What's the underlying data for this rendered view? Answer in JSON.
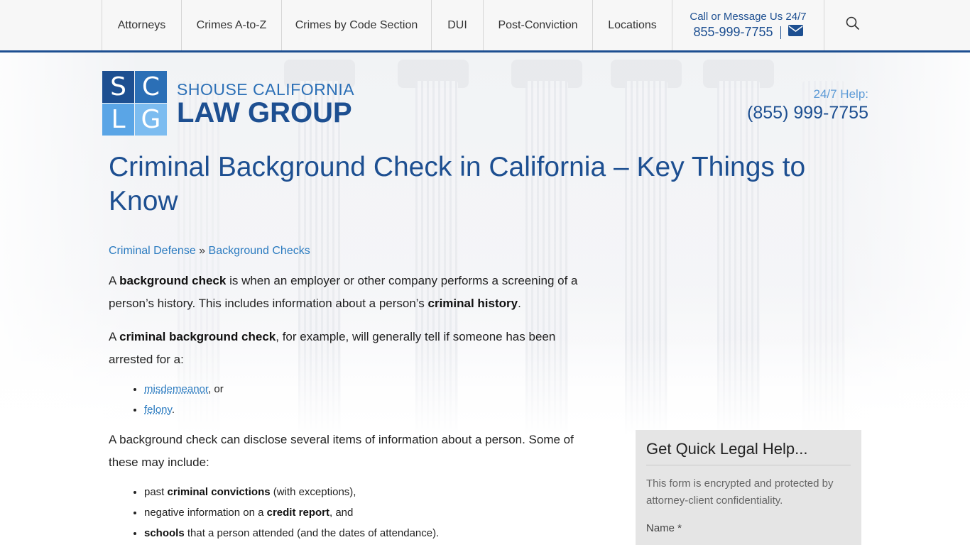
{
  "nav": {
    "items": [
      {
        "label": "Attorneys"
      },
      {
        "label": "Crimes A-to-Z"
      },
      {
        "label": "Crimes by Code Section"
      },
      {
        "label": "DUI"
      },
      {
        "label": "Post-Conviction"
      },
      {
        "label": "Locations"
      }
    ],
    "call_label": "Call or Message Us 24/7",
    "call_phone": "855-999-7755",
    "icons": [
      "envelope-icon",
      "search-icon"
    ]
  },
  "logo": {
    "letters": [
      "S",
      "C",
      "L",
      "G"
    ],
    "line1": "SHOUSE CALIFORNIA",
    "line2": "LAW GROUP",
    "colors": [
      "#1d4f91",
      "#2b6fb6",
      "#5aa5e6",
      "#7cbcf0"
    ]
  },
  "help": {
    "label": "24/7 Help:",
    "phone": "(855) 999-7755"
  },
  "page": {
    "title": "Criminal Background Check in California – Key Things to Know"
  },
  "breadcrumb": {
    "items": [
      "Criminal Defense",
      "Background Checks"
    ],
    "separator": "»"
  },
  "article": {
    "p1": {
      "a": "A ",
      "b": "background check",
      "c": " is when an employer or other company performs a screening of a person’s history. This includes information about a person’s ",
      "d": "criminal history",
      "e": "."
    },
    "p2": {
      "a": "A ",
      "b": "criminal background check",
      "c": ", for example, will generally tell if someone has been arrested for a:"
    },
    "list1": [
      {
        "link": "misdemeanor",
        "suffix": ", or"
      },
      {
        "link": "felony",
        "suffix": "."
      }
    ],
    "p3": "A background check can disclose several items of information about a person. Some of these may include:",
    "list2": [
      {
        "pre": "past ",
        "bold": "criminal convictions",
        "post": " (with exceptions),"
      },
      {
        "pre": "negative information on a ",
        "bold": "credit report",
        "post": ", and"
      },
      {
        "pre": "",
        "bold": "schools",
        "post": " that a person attended (and the dates of attendance)."
      }
    ]
  },
  "form": {
    "title": "Get Quick Legal Help...",
    "note": "This form is encrypted and protected by attorney-client confidentiality.",
    "name_label": "Name *"
  },
  "colors": {
    "primary": "#1d4f91",
    "link": "#2b7bc0",
    "help_label": "#5c9ad6"
  }
}
